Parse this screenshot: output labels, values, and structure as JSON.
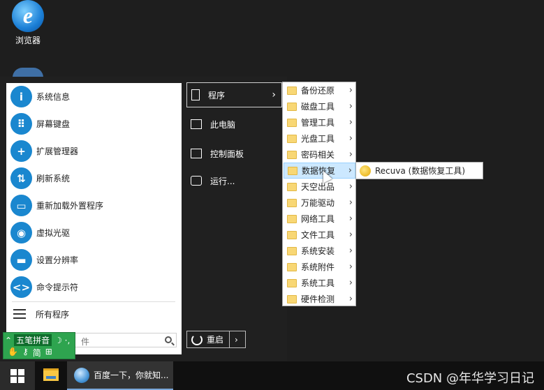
{
  "desktop": {
    "icons": [
      {
        "label": "浏览器",
        "icon": "ie-icon"
      }
    ]
  },
  "start_menu": {
    "left_items": [
      {
        "label": "系统信息",
        "icon": "info-icon",
        "glyph": "i"
      },
      {
        "label": "屏幕键盘",
        "icon": "keyboard-icon",
        "glyph": "⠿"
      },
      {
        "label": "扩展管理器",
        "icon": "plus-icon",
        "glyph": "+"
      },
      {
        "label": "刷新系统",
        "icon": "refresh-icon",
        "glyph": "⇅"
      },
      {
        "label": "重新加载外置程序",
        "icon": "box-icon",
        "glyph": "▭"
      },
      {
        "label": "虚拟光驱",
        "icon": "disc-icon",
        "glyph": "◉"
      },
      {
        "label": "设置分辨率",
        "icon": "monitor-icon",
        "glyph": "▬"
      },
      {
        "label": "命令提示符",
        "icon": "code-icon",
        "glyph": "<>"
      }
    ],
    "all_programs": "所有程序",
    "search_placeholder": "件",
    "right_items": [
      {
        "label": "程序",
        "icon": "program-icon",
        "arrow": "›"
      },
      {
        "label": "此电脑",
        "icon": "computer-icon"
      },
      {
        "label": "控制面板",
        "icon": "control-panel-icon"
      },
      {
        "label": "运行...",
        "icon": "run-icon"
      }
    ],
    "restart_label": "重启",
    "restart_chevron": "›"
  },
  "program_submenu": [
    "备份还原",
    "磁盘工具",
    "管理工具",
    "光盘工具",
    "密码相关",
    "数据恢复",
    "天空出品",
    "万能驱动",
    "网络工具",
    "文件工具",
    "系统安装",
    "系统附件",
    "系统工具",
    "硬件检测"
  ],
  "submenu_arrow": "›",
  "selected_submenu_index": 5,
  "flyout": {
    "label": "Recuva (数据恢复工具)"
  },
  "ime": {
    "name": "五笔拼音",
    "mode": "简",
    "symbols": "☽ ·,",
    "grid": "⊞"
  },
  "taskbar": {
    "active_window": "百度一下，你就知..."
  },
  "watermark": "CSDN @年华学习日记",
  "colors": {
    "accent": "#1a87cf",
    "folder": "#f8d775",
    "ime": "#2ea44f"
  }
}
